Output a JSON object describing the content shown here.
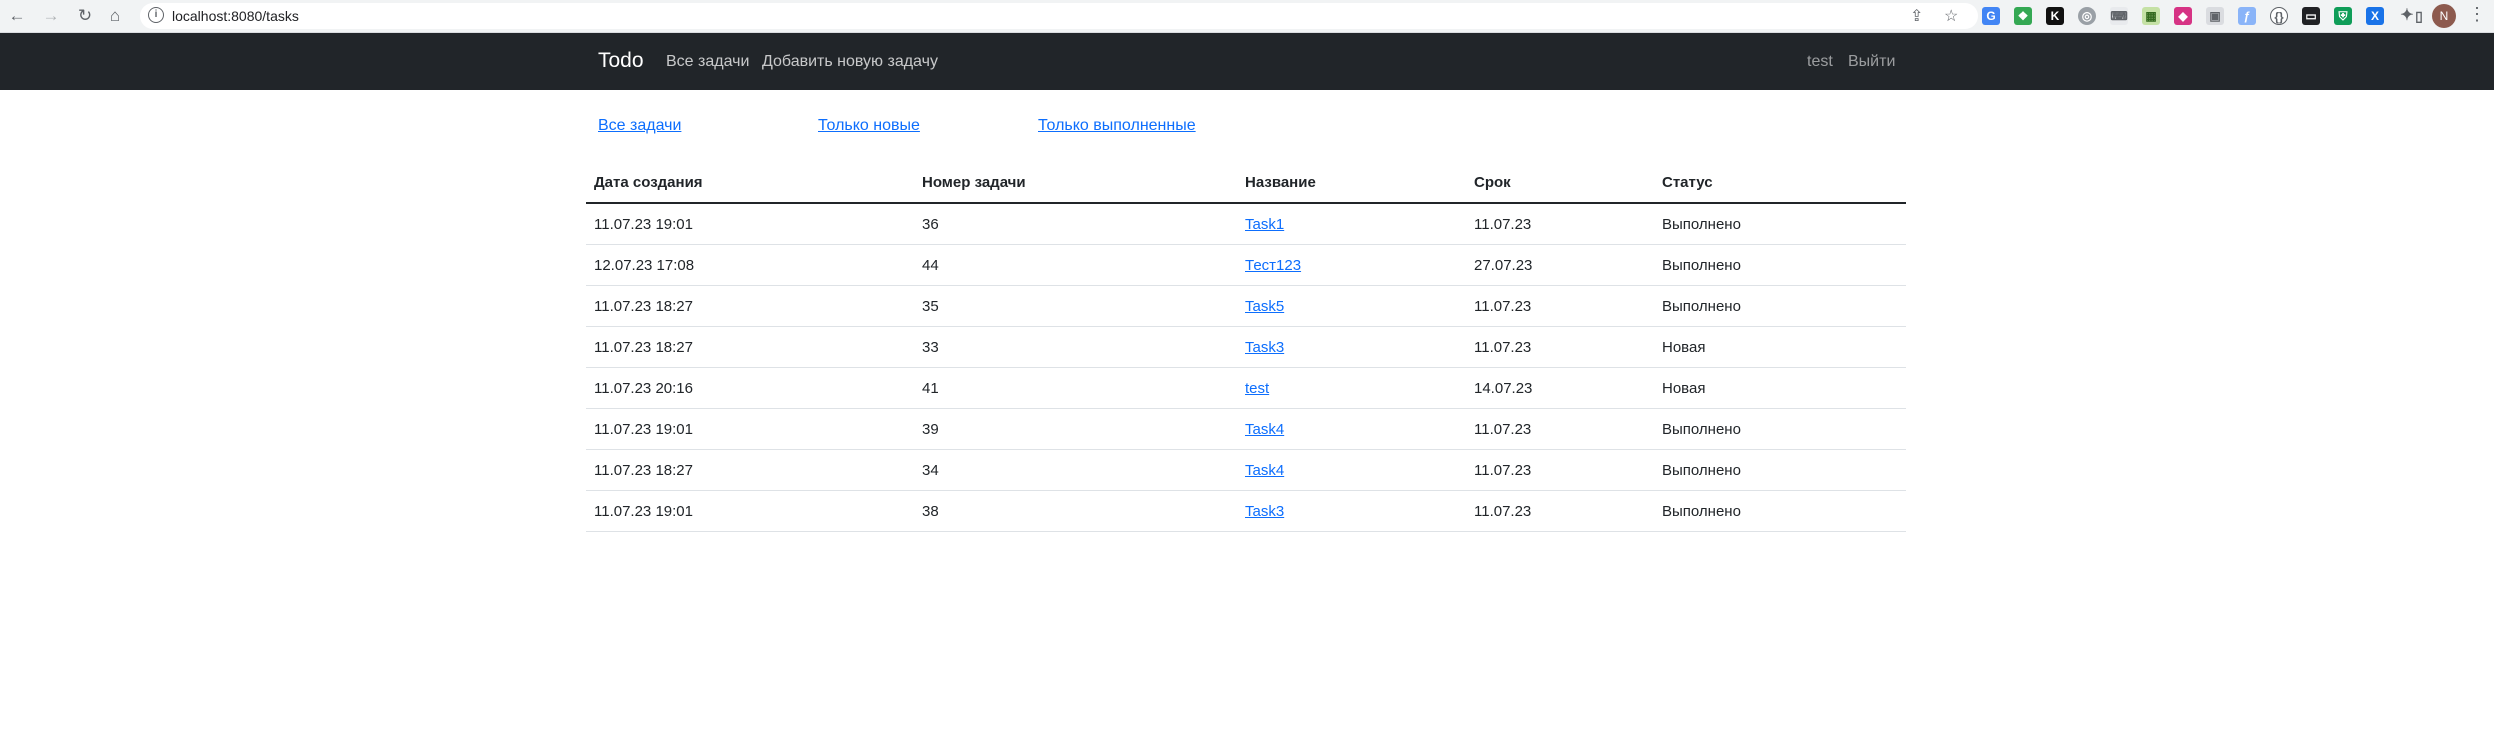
{
  "browser": {
    "url": "localhost:8080/tasks",
    "avatar_letter": "N"
  },
  "navbar": {
    "brand": "Todo",
    "links": [
      "Все задачи",
      "Добавить новую задачу"
    ],
    "user": "test",
    "logout": "Выйти"
  },
  "filters": [
    "Все задачи",
    "Только новые",
    "Только выполненные"
  ],
  "table": {
    "headers": [
      "Дата создания",
      "Номер задачи",
      "Название",
      "Срок",
      "Статус"
    ],
    "rows": [
      {
        "created": "11.07.23 19:01",
        "id": "36",
        "title": "Task1",
        "deadline": "11.07.23",
        "status": "Выполнено"
      },
      {
        "created": "12.07.23 17:08",
        "id": "44",
        "title": "Тест123",
        "deadline": "27.07.23",
        "status": "Выполнено"
      },
      {
        "created": "11.07.23 18:27",
        "id": "35",
        "title": "Task5",
        "deadline": "11.07.23",
        "status": "Выполнено"
      },
      {
        "created": "11.07.23 18:27",
        "id": "33",
        "title": "Task3",
        "deadline": "11.07.23",
        "status": "Новая"
      },
      {
        "created": "11.07.23 20:16",
        "id": "41",
        "title": "test",
        "deadline": "14.07.23",
        "status": "Новая"
      },
      {
        "created": "11.07.23 19:01",
        "id": "39",
        "title": "Task4",
        "deadline": "11.07.23",
        "status": "Выполнено"
      },
      {
        "created": "11.07.23 18:27",
        "id": "34",
        "title": "Task4",
        "deadline": "11.07.23",
        "status": "Выполнено"
      },
      {
        "created": "11.07.23 19:01",
        "id": "38",
        "title": "Task3",
        "deadline": "11.07.23",
        "status": "Выполнено"
      }
    ]
  }
}
